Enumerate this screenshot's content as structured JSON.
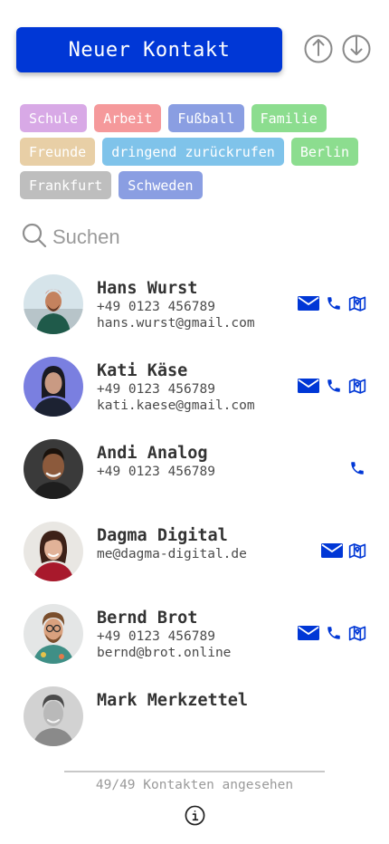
{
  "header": {
    "new_contact_label": "Neuer Kontakt",
    "upload_icon": "upload-icon",
    "download_icon": "download-icon"
  },
  "colors": {
    "primary": "#0037d6",
    "tag_schule": "#d8a9e6",
    "tag_arbeit": "#f5999b",
    "tag_fussball": "#8a9ee2",
    "tag_familie": "#8cdd8f",
    "tag_freunde": "#e8cfa6",
    "tag_dringend": "#7fc3ea",
    "tag_berlin": "#8cdd8f",
    "tag_frankfurt": "#bebebe",
    "tag_schweden": "#8a9ee2"
  },
  "tags": [
    {
      "label": "Schule",
      "color": "#d8a9e6"
    },
    {
      "label": "Arbeit",
      "color": "#f5999b"
    },
    {
      "label": "Fußball",
      "color": "#8a9ee2"
    },
    {
      "label": "Familie",
      "color": "#8cdd8f"
    },
    {
      "label": "Freunde",
      "color": "#e8cfa6"
    },
    {
      "label": "dringend zurückrufen",
      "color": "#7fc3ea"
    },
    {
      "label": "Berlin",
      "color": "#8cdd8f"
    },
    {
      "label": "Frankfurt",
      "color": "#bebebe"
    },
    {
      "label": "Schweden",
      "color": "#8a9ee2"
    }
  ],
  "search": {
    "placeholder": "Suchen",
    "icon": "search-icon"
  },
  "contacts": [
    {
      "name": "Hans Wurst",
      "phone": "+49 0123 456789",
      "email": "hans.wurst@gmail.com",
      "actions": [
        "mail",
        "phone",
        "map"
      ]
    },
    {
      "name": "Kati Käse",
      "phone": "+49 0123 456789",
      "email": "kati.kaese@gmail.com",
      "actions": [
        "mail",
        "phone",
        "map"
      ]
    },
    {
      "name": "Andi Analog",
      "phone": "+49 0123 456789",
      "email": "",
      "actions": [
        "phone"
      ]
    },
    {
      "name": "Dagma Digital",
      "phone": "me@dagma-digital.de",
      "email": "",
      "actions": [
        "mail",
        "map"
      ]
    },
    {
      "name": "Bernd Brot",
      "phone": "+49 0123 456789",
      "email": "bernd@brot.online",
      "actions": [
        "mail",
        "phone",
        "map"
      ]
    },
    {
      "name": "Mark Merkzettel",
      "phone": "",
      "email": "",
      "actions": []
    }
  ],
  "footer": {
    "count_text": "49/49 Kontakten angesehen",
    "info_icon": "info-icon"
  }
}
